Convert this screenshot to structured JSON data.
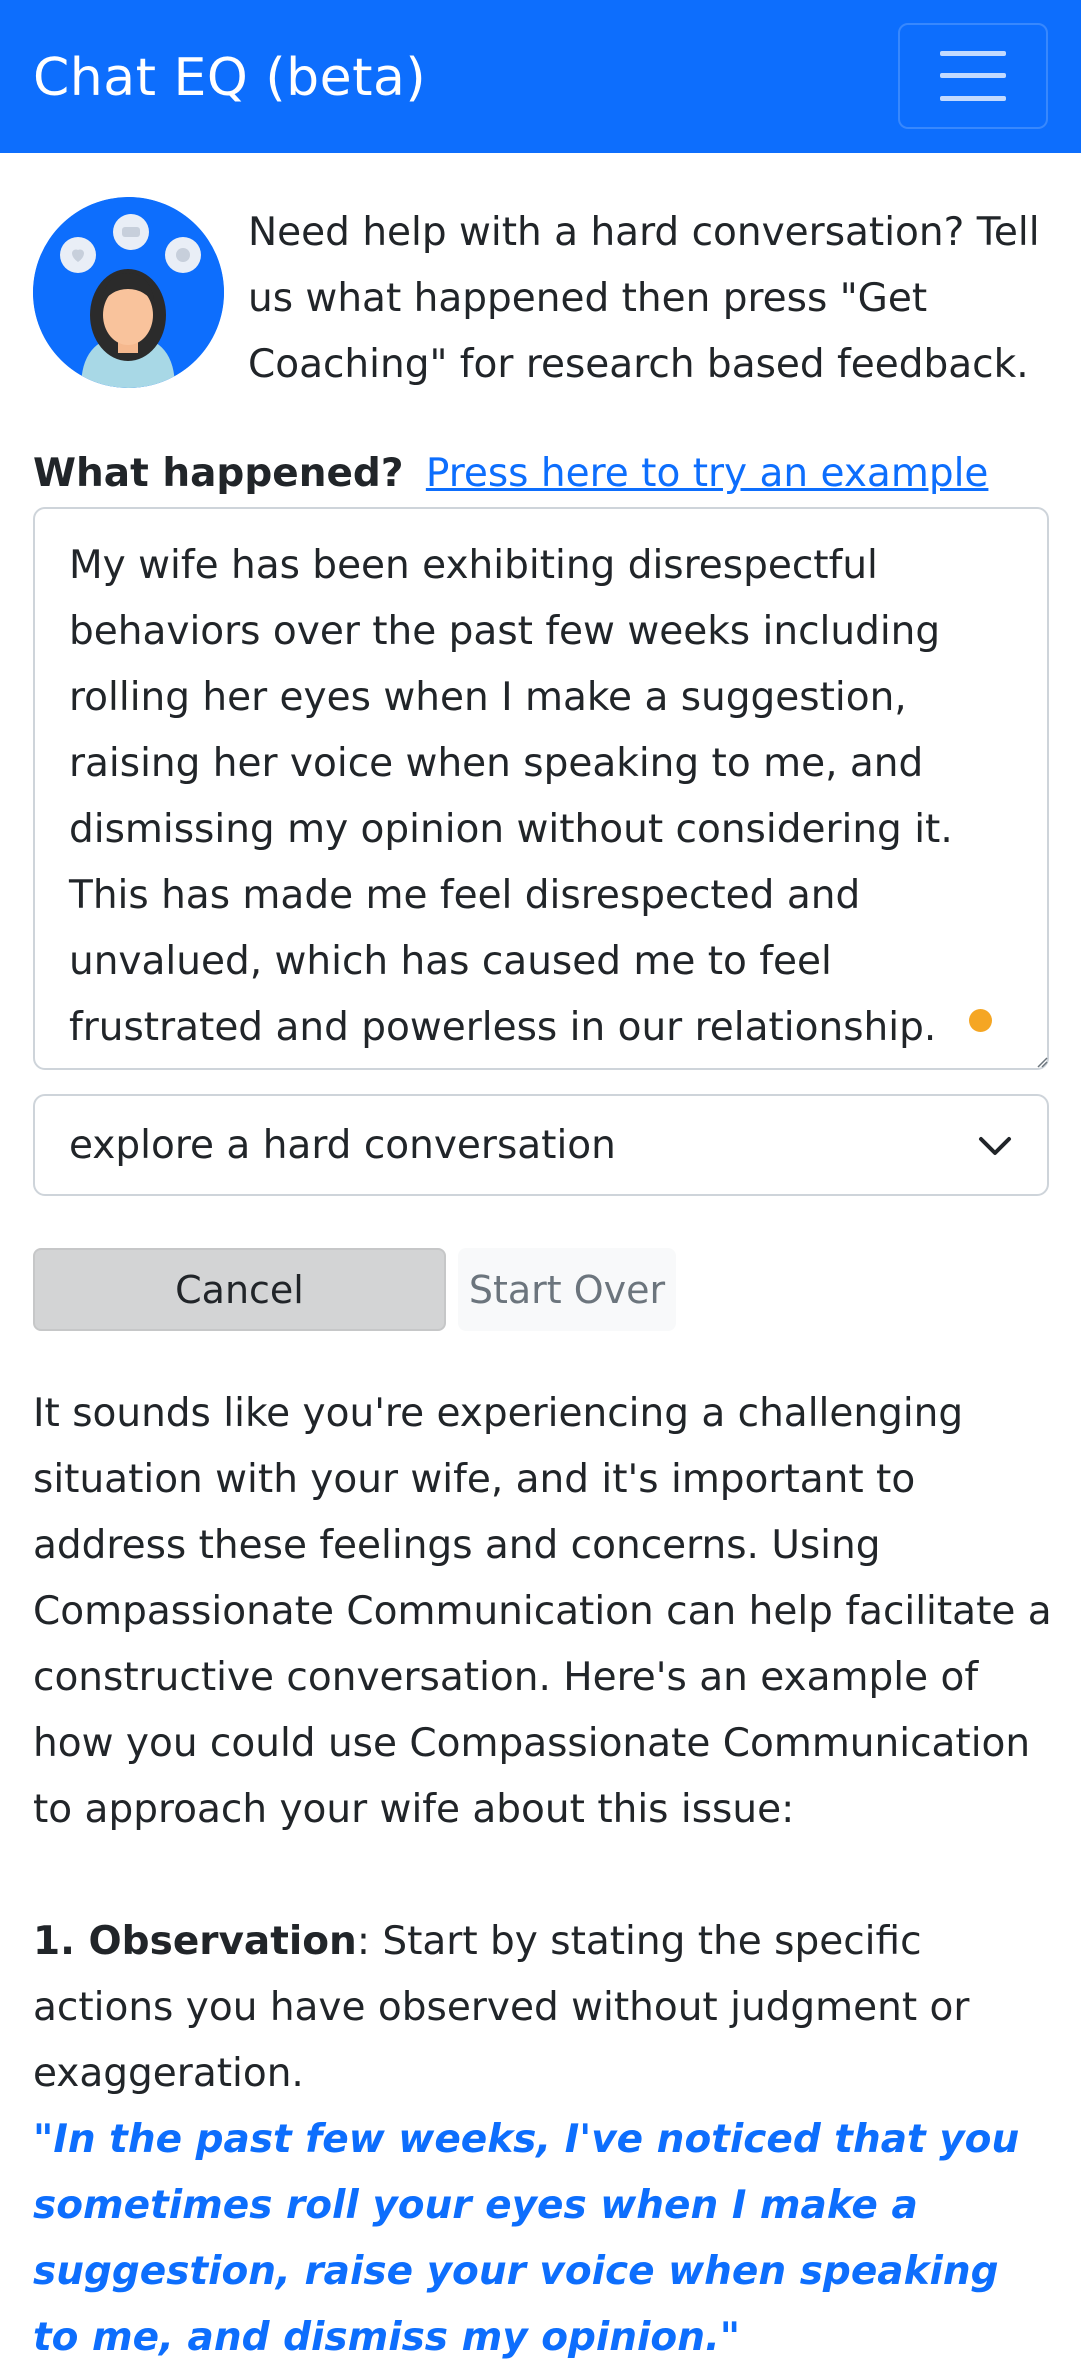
{
  "navbar": {
    "brand": "Chat EQ (beta)",
    "menu_icon": "hamburger-menu-icon",
    "background": "#0d6efd"
  },
  "intro": {
    "avatar_icon": "coach-avatar-icon",
    "text": "Need help with a hard conversation? Tell us what happened then press \"Get Coaching\" for research based feedback."
  },
  "form": {
    "what_label": "What happened?",
    "example_link": "Press here to try an example",
    "situation_text": "My wife has been exhibiting disrespectful behaviors over the past few weeks including rolling her eyes when I make a suggestion, raising her voice when speaking to me, and dismissing my opinion without considering it. This has made me feel disrespected and unvalued, which has caused me to feel frustrated and powerless in our relationship.",
    "mode_selected": "explore a hard conversation",
    "cancel_label": "Cancel",
    "start_over_label": "Start Over"
  },
  "response": {
    "intro": "It sounds like you're experiencing a challenging situation with your wife, and it's important to address these feelings and concerns. Using Compassionate Communication can help facilitate a constructive conversation. Here's an example of how you could use Compassionate Communication to approach your wife about this issue:",
    "step1_title": "1. Observation",
    "step1_text": ": Start by stating the specific actions you have observed without judgment or exaggeration.",
    "step1_quote": "\"In the past few weeks, I've noticed that you sometimes roll your eyes when I make a suggestion, raise your voice when speaking to me, and dismiss my opinion.\""
  },
  "colors": {
    "primary": "#0d6efd",
    "text": "#212529",
    "indicator": "#f5a623"
  }
}
